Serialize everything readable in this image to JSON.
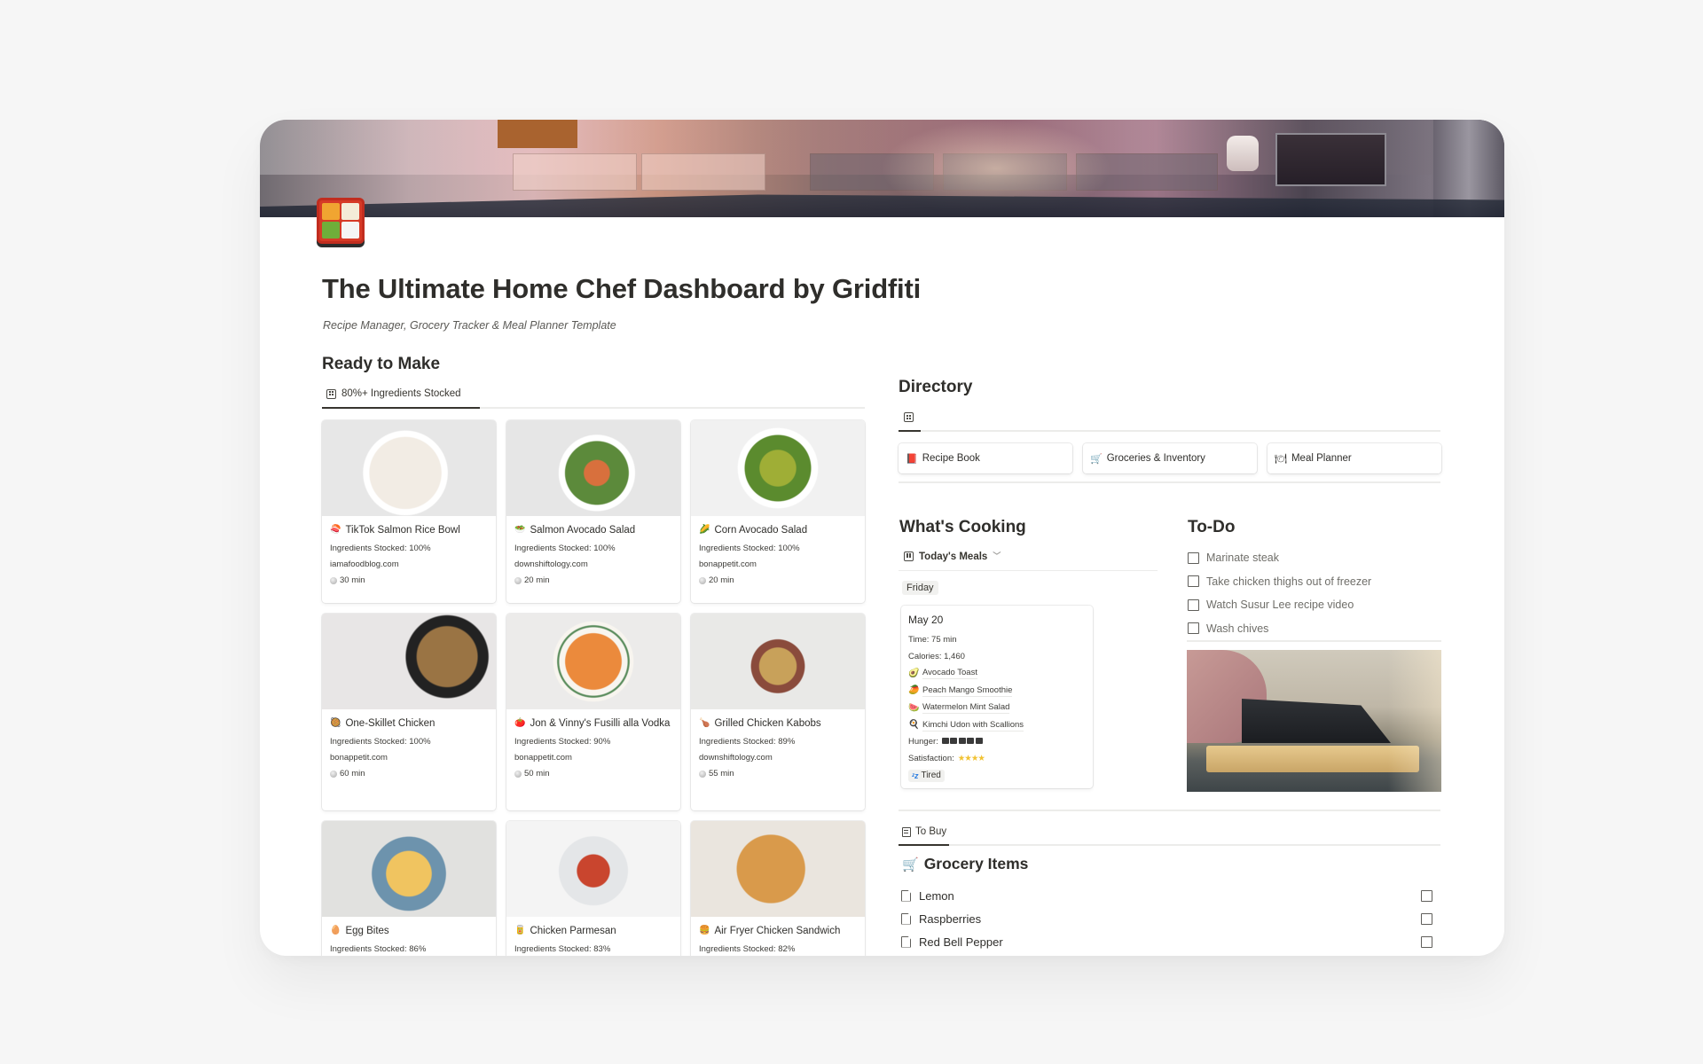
{
  "page": {
    "title": "The Ultimate Home Chef Dashboard by Gridfiti",
    "subtitle": "Recipe Manager, Grocery Tracker & Meal Planner Template",
    "icon": "bento-box-icon"
  },
  "ready_to_make": {
    "heading": "Ready to Make",
    "view_tab": "80%+ Ingredients Stocked",
    "recipes": [
      {
        "emoji": "🍣",
        "name": "TikTok Salmon Rice Bowl",
        "stocked": "Ingredients Stocked: 100%",
        "source": "iamafoodblog.com",
        "time": "30 min"
      },
      {
        "emoji": "🥗",
        "name": "Salmon Avocado Salad",
        "stocked": "Ingredients Stocked: 100%",
        "source": "downshiftology.com",
        "time": "20 min"
      },
      {
        "emoji": "🌽",
        "name": "Corn Avocado Salad",
        "stocked": "Ingredients Stocked: 100%",
        "source": "bonappetit.com",
        "time": "20 min"
      },
      {
        "emoji": "🥘",
        "name": "One-Skillet Chicken",
        "stocked": "Ingredients Stocked: 100%",
        "source": "bonappetit.com",
        "time": "60 min"
      },
      {
        "emoji": "🍅",
        "name": "Jon & Vinny's Fusilli alla Vodka",
        "stocked": "Ingredients Stocked: 90%",
        "source": "bonappetit.com",
        "time": "50 min"
      },
      {
        "emoji": "🍗",
        "name": "Grilled Chicken Kabobs",
        "stocked": "Ingredients Stocked: 89%",
        "source": "downshiftology.com",
        "time": "55 min"
      },
      {
        "emoji": "🥚",
        "name": "Egg Bites",
        "stocked": "Ingredients Stocked: 86%",
        "source": "",
        "time": ""
      },
      {
        "emoji": "🥫",
        "name": "Chicken Parmesan",
        "stocked": "Ingredients Stocked: 83%",
        "source": "",
        "time": ""
      },
      {
        "emoji": "🍔",
        "name": "Air Fryer Chicken Sandwich",
        "stocked": "Ingredients Stocked: 82%",
        "source": "",
        "time": ""
      }
    ]
  },
  "directory": {
    "heading": "Directory",
    "links": [
      {
        "emoji": "📕",
        "label": "Recipe Book"
      },
      {
        "emoji": "🛒",
        "label": "Groceries & Inventory"
      },
      {
        "emoji": "🍽",
        "label": "Meal Planner"
      }
    ]
  },
  "whats_cooking": {
    "heading": "What's Cooking",
    "view_selector": "Today's Meals",
    "group": "Friday",
    "meal_card": {
      "date": "May 20",
      "time": "Time: 75 min",
      "calories": "Calories: 1,460",
      "meals": [
        {
          "emoji": "🥑",
          "label": "Avocado Toast"
        },
        {
          "emoji": "🥭",
          "label": "Peach Mango Smoothie"
        },
        {
          "emoji": "🍉",
          "label": "Watermelon Mint Salad"
        },
        {
          "emoji": "🍳",
          "label": "Kimchi Udon with Scallions"
        }
      ],
      "hunger_label": "Hunger:",
      "hunger_level": 5,
      "hunger_max": 5,
      "satisfaction_label": "Satisfaction:",
      "satisfaction_stars": 4,
      "mood": "Tired"
    }
  },
  "todo": {
    "heading": "To-Do",
    "items": [
      {
        "label": "Marinate steak",
        "checked": false
      },
      {
        "label": "Take chicken thighs out of freezer",
        "checked": false
      },
      {
        "label": "Watch Susur Lee recipe video",
        "checked": false
      },
      {
        "label": "Wash chives",
        "checked": false
      }
    ]
  },
  "grocery": {
    "view_tab": "To Buy",
    "heading": "Grocery Items",
    "heading_emoji": "🛒",
    "items": [
      {
        "label": "Lemon",
        "checked": false
      },
      {
        "label": "Raspberries",
        "checked": false
      },
      {
        "label": "Red Bell Pepper",
        "checked": false
      }
    ]
  }
}
